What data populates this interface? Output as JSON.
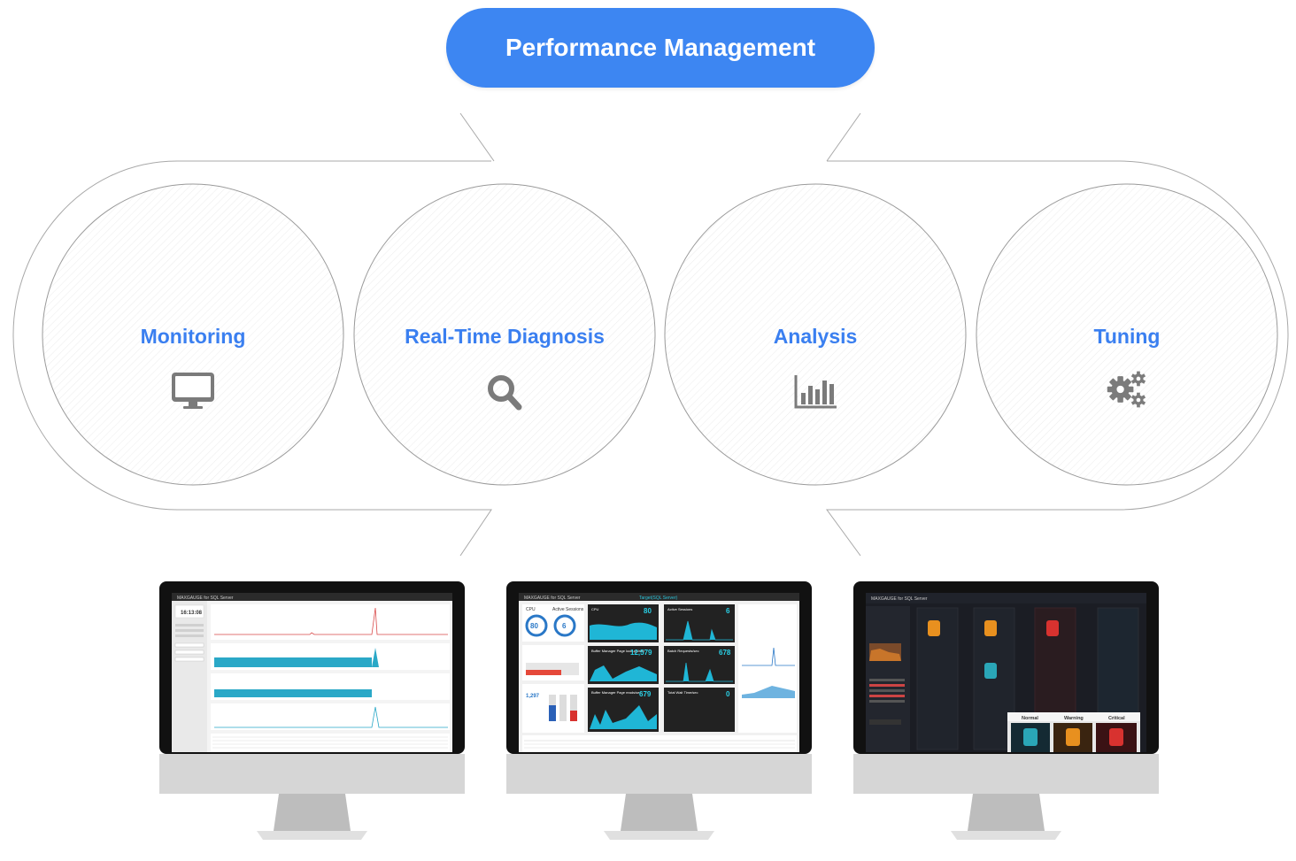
{
  "title": "Performance Management",
  "colors": {
    "accent": "#3a7ff0",
    "title_bg": "#3d86f2",
    "outline": "#9a9a9a",
    "icon": "#7b7b7b"
  },
  "stages": [
    {
      "label": "Monitoring",
      "icon": "monitor-icon"
    },
    {
      "label": "Real-Time Diagnosis",
      "icon": "search-icon"
    },
    {
      "label": "Analysis",
      "icon": "bar-chart-icon"
    },
    {
      "label": "Tuning",
      "icon": "gears-icon"
    }
  ],
  "screens": [
    {
      "name": "monitoring-screen",
      "app_title": "MAXGAUGE for SQL Server",
      "clock": "16:13:08"
    },
    {
      "name": "diagnosis-screen",
      "app_title": "MAXGAUGE for SQL Server",
      "center_title": "Target(SQL Server)",
      "panels": [
        {
          "label": "CPU",
          "value": "80"
        },
        {
          "label": "Active Sessions",
          "value": "6"
        },
        {
          "label": "Buffer Manager Page lookups/sec",
          "value": "12,579"
        },
        {
          "label": "Batch Requests/sec",
          "value": "678"
        },
        {
          "label": "Buffer Manager Page reads/sec",
          "value": "679"
        },
        {
          "label": "Total Wait Time/sec",
          "value": "0"
        }
      ],
      "gauges": {
        "cpu": "80",
        "sessions": "6",
        "lower": "1,297"
      }
    },
    {
      "name": "analysis-screen",
      "app_title": "MAXGAUGE for SQL Server",
      "legend": [
        "Normal",
        "Warning",
        "Critical"
      ]
    }
  ]
}
